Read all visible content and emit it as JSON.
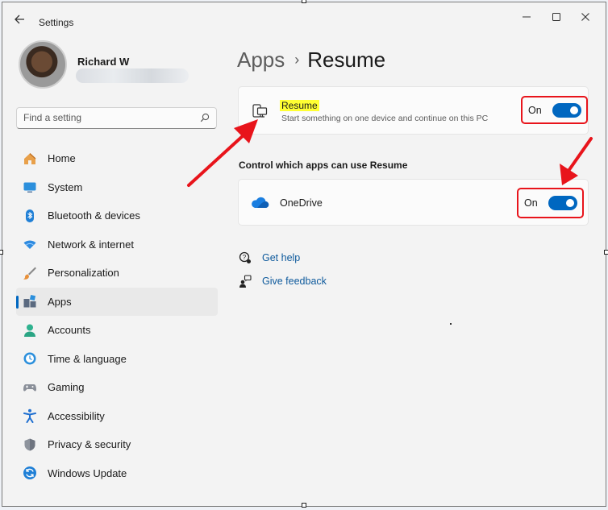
{
  "window": {
    "title": "Settings",
    "controls": [
      "minimize",
      "maximize",
      "close"
    ]
  },
  "profile": {
    "name": "Richard W"
  },
  "search": {
    "placeholder": "Find a setting"
  },
  "sidebar": {
    "items": [
      {
        "label": "Home",
        "icon": "home-icon",
        "selected": false
      },
      {
        "label": "System",
        "icon": "system-icon",
        "selected": false
      },
      {
        "label": "Bluetooth & devices",
        "icon": "bluetooth-icon",
        "selected": false
      },
      {
        "label": "Network & internet",
        "icon": "network-icon",
        "selected": false
      },
      {
        "label": "Personalization",
        "icon": "brush-icon",
        "selected": false
      },
      {
        "label": "Apps",
        "icon": "apps-icon",
        "selected": true
      },
      {
        "label": "Accounts",
        "icon": "accounts-icon",
        "selected": false
      },
      {
        "label": "Time & language",
        "icon": "time-language-icon",
        "selected": false
      },
      {
        "label": "Gaming",
        "icon": "gaming-icon",
        "selected": false
      },
      {
        "label": "Accessibility",
        "icon": "accessibility-icon",
        "selected": false
      },
      {
        "label": "Privacy & security",
        "icon": "shield-icon",
        "selected": false
      },
      {
        "label": "Windows Update",
        "icon": "update-icon",
        "selected": false
      }
    ]
  },
  "breadcrumb": {
    "parent": "Apps",
    "separator": "›",
    "current": "Resume"
  },
  "resume_card": {
    "title": "Resume",
    "description": "Start something on one device and continue on this PC",
    "toggle_label": "On",
    "toggle_on": true
  },
  "section": {
    "heading": "Control which apps can use Resume"
  },
  "onedrive_card": {
    "label": "OneDrive",
    "toggle_label": "On",
    "toggle_on": true
  },
  "links": {
    "get_help": "Get help",
    "give_feedback": "Give feedback"
  },
  "colors": {
    "accent": "#0067c0",
    "annotation_red": "#e8141b",
    "highlight_yellow": "#ffff33"
  }
}
